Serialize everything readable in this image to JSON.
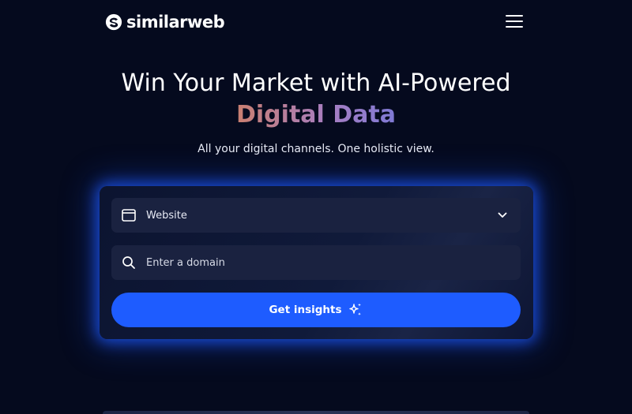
{
  "header": {
    "logo_text": "similarweb",
    "logo_icon": "similarweb-logo-icon",
    "menu_icon": "hamburger-menu-icon"
  },
  "hero": {
    "title_line1": "Win Your Market with AI-Powered",
    "title_line2": "Digital Data",
    "subtitle": "All your digital channels. One holistic view."
  },
  "search_card": {
    "type_select": {
      "icon": "browser-window-icon",
      "selected_value": "Website",
      "chevron_icon": "chevron-down-icon"
    },
    "domain_input": {
      "icon": "search-icon",
      "placeholder": "Enter a domain",
      "value": ""
    },
    "cta": {
      "label": "Get insights",
      "icon": "sparkle-icon"
    }
  },
  "colors": {
    "background": "#050a1e",
    "accent": "#1e5cff",
    "gradient_start": "#ff7a2e",
    "gradient_end": "#3d6cf0"
  }
}
